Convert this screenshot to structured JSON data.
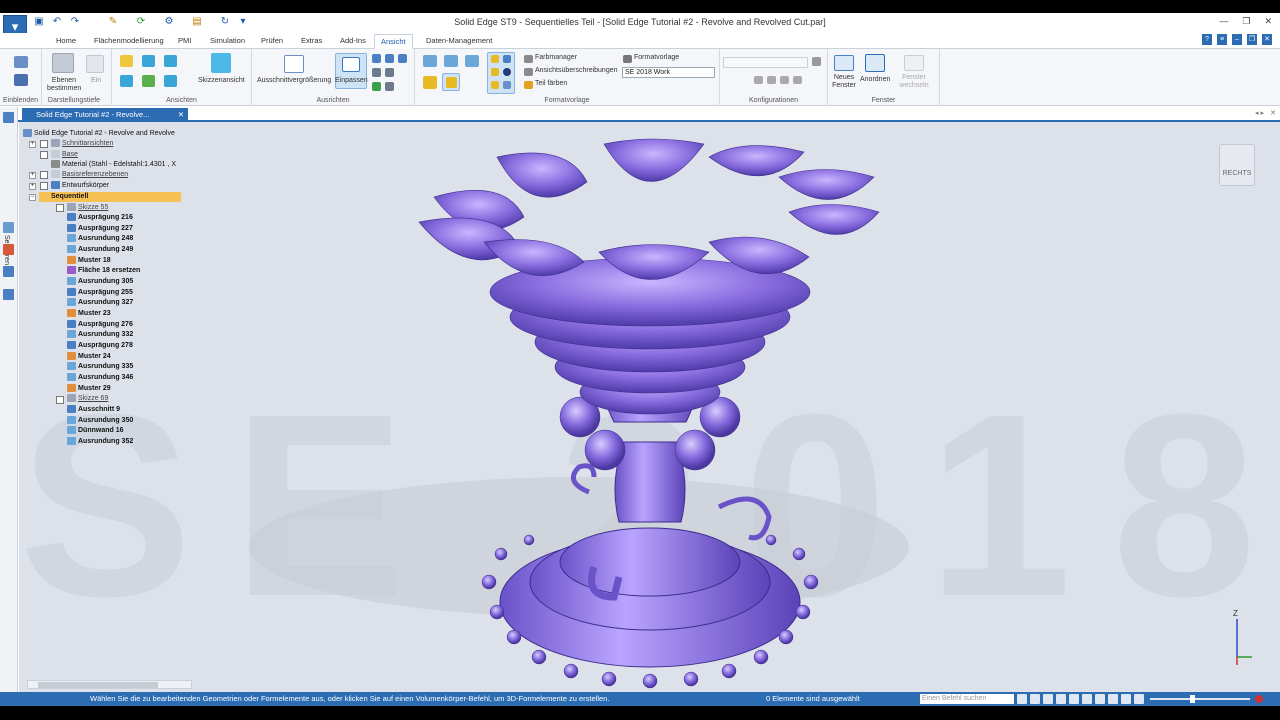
{
  "app": {
    "title": "Solid Edge ST9 - Sequentielles Teil - [Solid Edge Tutorial #2 - Revolve and Revolved Cut.par]"
  },
  "tabs": [
    {
      "label": "Home"
    },
    {
      "label": "Flächenmodellierung"
    },
    {
      "label": "PMI"
    },
    {
      "label": "Simulation"
    },
    {
      "label": "Prüfen"
    },
    {
      "label": "Extras"
    },
    {
      "label": "Add-Ins"
    },
    {
      "label": "Ansicht"
    },
    {
      "label": "Daten-Management"
    }
  ],
  "ribbon": {
    "einblenden": "Einblenden",
    "ebenen_bestimmen": "Ebenen bestimmen",
    "ein": "Ein",
    "darstellungstiefe": "Darstellungstiefe",
    "skizzenansicht": "Skizzenansicht",
    "ansichten": "Ansichten",
    "ausschnitt": "Ausschnittvergrößerung",
    "einpassen": "Einpassen",
    "ausrichten": "Ausrichten",
    "farbmanager": "Farbmanager",
    "ansichtsueberschreibungen": "Ansichtsüberschreibungen",
    "teil_faerben": "Teil färben",
    "formatvorlage": "Formatvorlage",
    "formatvorlage_value": "SE 2018 Work",
    "formatvorlage_group": "Formatvorlage",
    "konfigurationen": "Konfigurationen",
    "neues_fenster": "Neues Fenster",
    "anordnen": "Anordnen",
    "fenster_wechseln": "Fenster wechseln",
    "fenster": "Fenster"
  },
  "document_tab": "Solid Edge Tutorial #2 - Revolve...",
  "sidebar": {
    "sensoren": "Sensoren"
  },
  "tree": {
    "root": "Solid Edge Tutorial #2 - Revolve and Revolve",
    "items": [
      "Schnittansichten",
      "Base",
      "Material (Stahl - Edelstahl:1.4301 , X",
      "Basisreferenzebenen",
      "Entwurfskörper",
      "Sequentiell",
      "Skizze 55",
      "Ausprägung 216",
      "Ausprägung 227",
      "Ausrundung 248",
      "Ausrundung 249",
      "Muster 18",
      "Fläche 18 ersetzen",
      "Ausrundung 305",
      "Ausprägung 255",
      "Ausrundung 327",
      "Muster 23",
      "Ausprägung 276",
      "Ausrundung 332",
      "Ausprägung 278",
      "Muster 24",
      "Ausrundung 335",
      "Ausrundung 346",
      "Muster 29",
      "Skizze 69",
      "Ausschnitt 9",
      "Ausrundung 350",
      "Dünnwand 16",
      "Ausrundung 352"
    ]
  },
  "viewport": {
    "watermark": "SE 2018",
    "view_cube": "RECHTS",
    "axis_z": "Z"
  },
  "status": {
    "prompt": "Wählen Sie die zu bearbeitenden Geometrien oder Formelemente aus, oder klicken Sie auf einen Volumenkörper-Befehl, um 3D-Formelemente zu erstellen.",
    "selection": "0 Elemente sind ausgewählt",
    "command_placeholder": "Einen Befehl suchen"
  },
  "colors": {
    "accent": "#2b6cb3",
    "model": "#8a6ee0",
    "sequence_highlight": "#f7c255"
  }
}
